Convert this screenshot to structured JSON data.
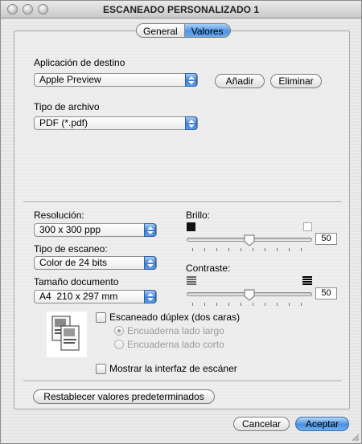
{
  "window": {
    "title": "ESCANEADO PERSONALIZADO 1"
  },
  "tabs": [
    {
      "label": "General",
      "active": false
    },
    {
      "label": "Valores",
      "active": true
    }
  ],
  "destination": {
    "label": "Aplicación de destino",
    "value": "Apple Preview",
    "add_label": "Añadir",
    "remove_label": "Eliminar"
  },
  "file_type": {
    "label": "Tipo de archivo",
    "value": "PDF (*.pdf)"
  },
  "resolution": {
    "label": "Resolución:",
    "value": "300 x 300 ppp"
  },
  "scan_type": {
    "label": "Tipo de escaneo:",
    "value": "Color de 24 bits"
  },
  "doc_size": {
    "label": "Tamaño documento",
    "value": "A4  210 x 297 mm"
  },
  "brightness": {
    "label": "Brillo:",
    "value": "50",
    "level": 0.5
  },
  "contrast": {
    "label": "Contraste:",
    "value": "50",
    "level": 0.5
  },
  "duplex": {
    "label": "Escaneado dúplex (dos caras)",
    "checked": false,
    "long_edge": "Encuaderna lado largo",
    "short_edge": "Encuaderna lado corto"
  },
  "show_interface": {
    "label": "Mostrar la interfaz de escáner",
    "checked": false
  },
  "restore_defaults_label": "Restablecer valores predeterminados",
  "cancel_label": "Cancelar",
  "accept_label": "Aceptar",
  "colors": {
    "accent": "#4f95e4",
    "window_bg": "#ececec"
  }
}
